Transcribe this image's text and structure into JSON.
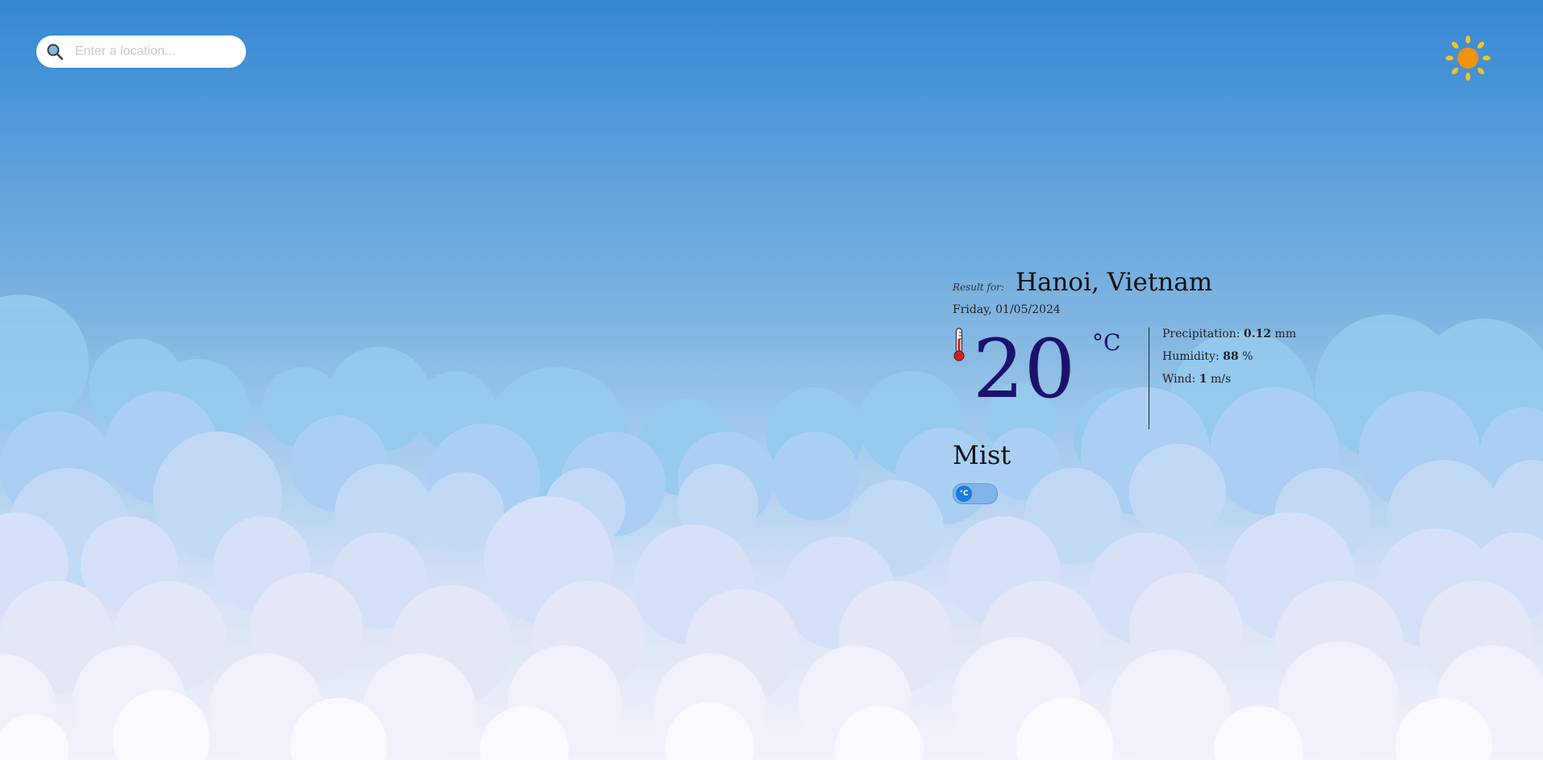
{
  "search": {
    "placeholder": "Enter a location..."
  },
  "icons": {
    "search": "magnifier-icon",
    "theme_toggle": "sun-icon",
    "thermometer": "thermometer-icon"
  },
  "weather": {
    "result_label": "Result for:",
    "location": "Hanoi, Vietnam",
    "date": "Friday, 01/05/2024",
    "temperature": "20",
    "unit": "°C",
    "condition": "Mist",
    "details": {
      "precipitation_label": "Precipitation:",
      "precipitation_value": "0.12",
      "precipitation_unit": "mm",
      "humidity_label": "Humidity:",
      "humidity_value": "88",
      "humidity_unit": "%",
      "wind_label": "Wind:",
      "wind_value": "1",
      "wind_unit": "m/s"
    }
  },
  "unit_toggle": {
    "label": "°C"
  },
  "colors": {
    "sky_top": "#3587d2",
    "temperature": "#1a126b",
    "sun": "#f0920c",
    "sun_rays": "#f5c518",
    "toggle": "#1a7be0"
  }
}
